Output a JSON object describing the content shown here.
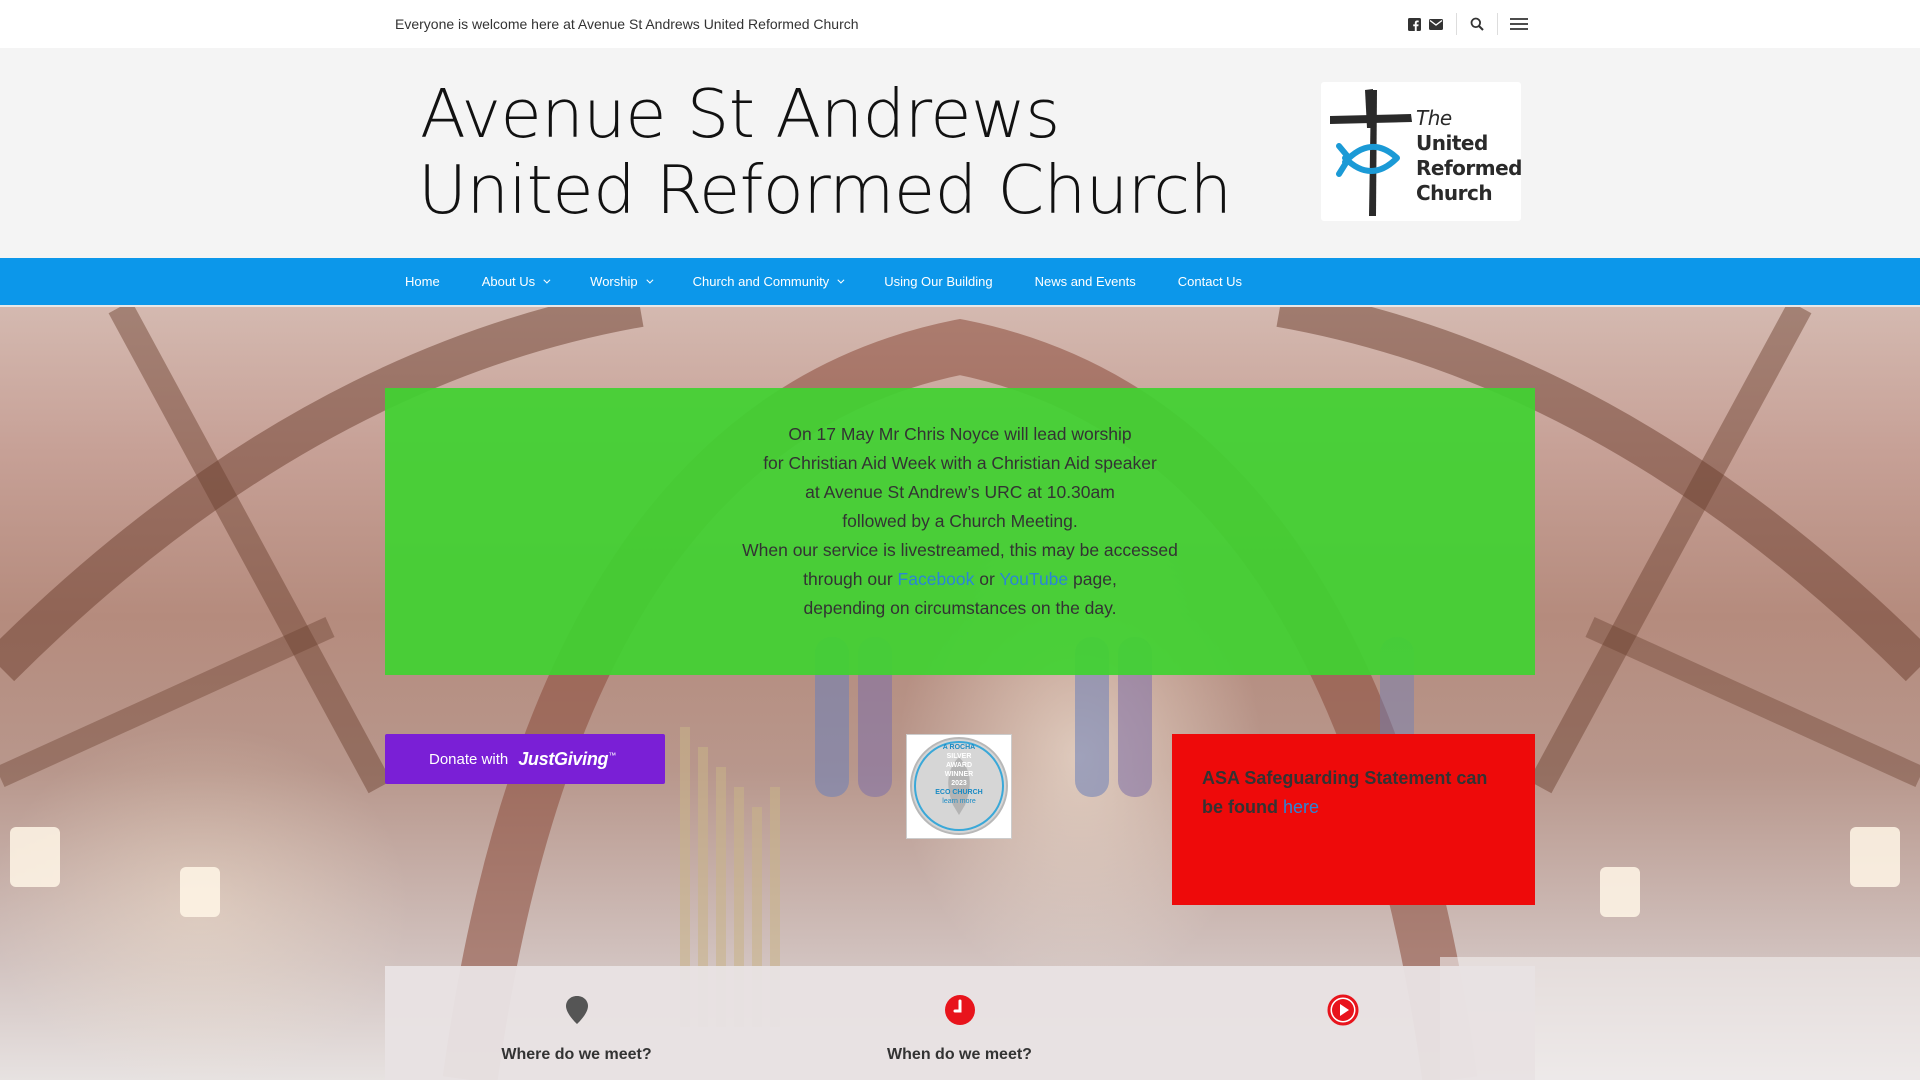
{
  "topbar": {
    "tagline": "Everyone is welcome here at Avenue St Andrews United Reformed Church",
    "icons": [
      "facebook-icon",
      "email-icon",
      "search-icon",
      "menu-icon"
    ]
  },
  "header": {
    "title_line1": "Avenue St Andrews",
    "title_line2": "United Reformed Church",
    "logo": {
      "the": "The",
      "line2": "United",
      "line3": "Reformed",
      "line4": "Church"
    }
  },
  "nav": {
    "items": [
      {
        "label": "Home",
        "dropdown": false
      },
      {
        "label": "About Us",
        "dropdown": true
      },
      {
        "label": "Worship",
        "dropdown": true
      },
      {
        "label": "Church and Community",
        "dropdown": true
      },
      {
        "label": "Using Our Building",
        "dropdown": false
      },
      {
        "label": "News and Events",
        "dropdown": false
      },
      {
        "label": "Contact Us",
        "dropdown": false
      }
    ]
  },
  "notice": {
    "line1": "On 17 May Mr Chris Noyce will lead worship",
    "line2": "for Christian Aid Week with a Christian Aid speaker",
    "line3": "at Avenue St Andrew’s URC at 10.30am",
    "line4": "followed by a Church Meeting.",
    "line5": "When our service is livestreamed, this may be accessed",
    "line6_pre": "through our ",
    "facebook_link": "Facebook",
    "line6_mid": " or ",
    "youtube_link": "YouTube",
    "line6_post": " page,",
    "line7": "depending on circumstances on the day."
  },
  "donate": {
    "with": "Donate with",
    "brand": "JustGiving",
    "tm": "™"
  },
  "eco_badge": {
    "line1": "A ROCHA",
    "line2": "SILVER",
    "line3": "AWARD",
    "line4": "WINNER",
    "line5": "2023",
    "line6": "ECO CHURCH",
    "line7": "learn more"
  },
  "safeguarding": {
    "text": "ASA Safeguarding Statement can be found ",
    "link": "here"
  },
  "info": [
    {
      "icon": "map-pin-icon",
      "label": "Where do we meet?"
    },
    {
      "icon": "clock-icon",
      "label": "When do we meet?"
    },
    {
      "icon": "play-icon",
      "label": ""
    }
  ],
  "colors": {
    "nav": "#0c97ea",
    "notice": "#41d232",
    "donate": "#7a1fd6",
    "safeguarding": "#ee0a0a",
    "link": "#2a86d6",
    "accent_red": "#e8141c"
  }
}
